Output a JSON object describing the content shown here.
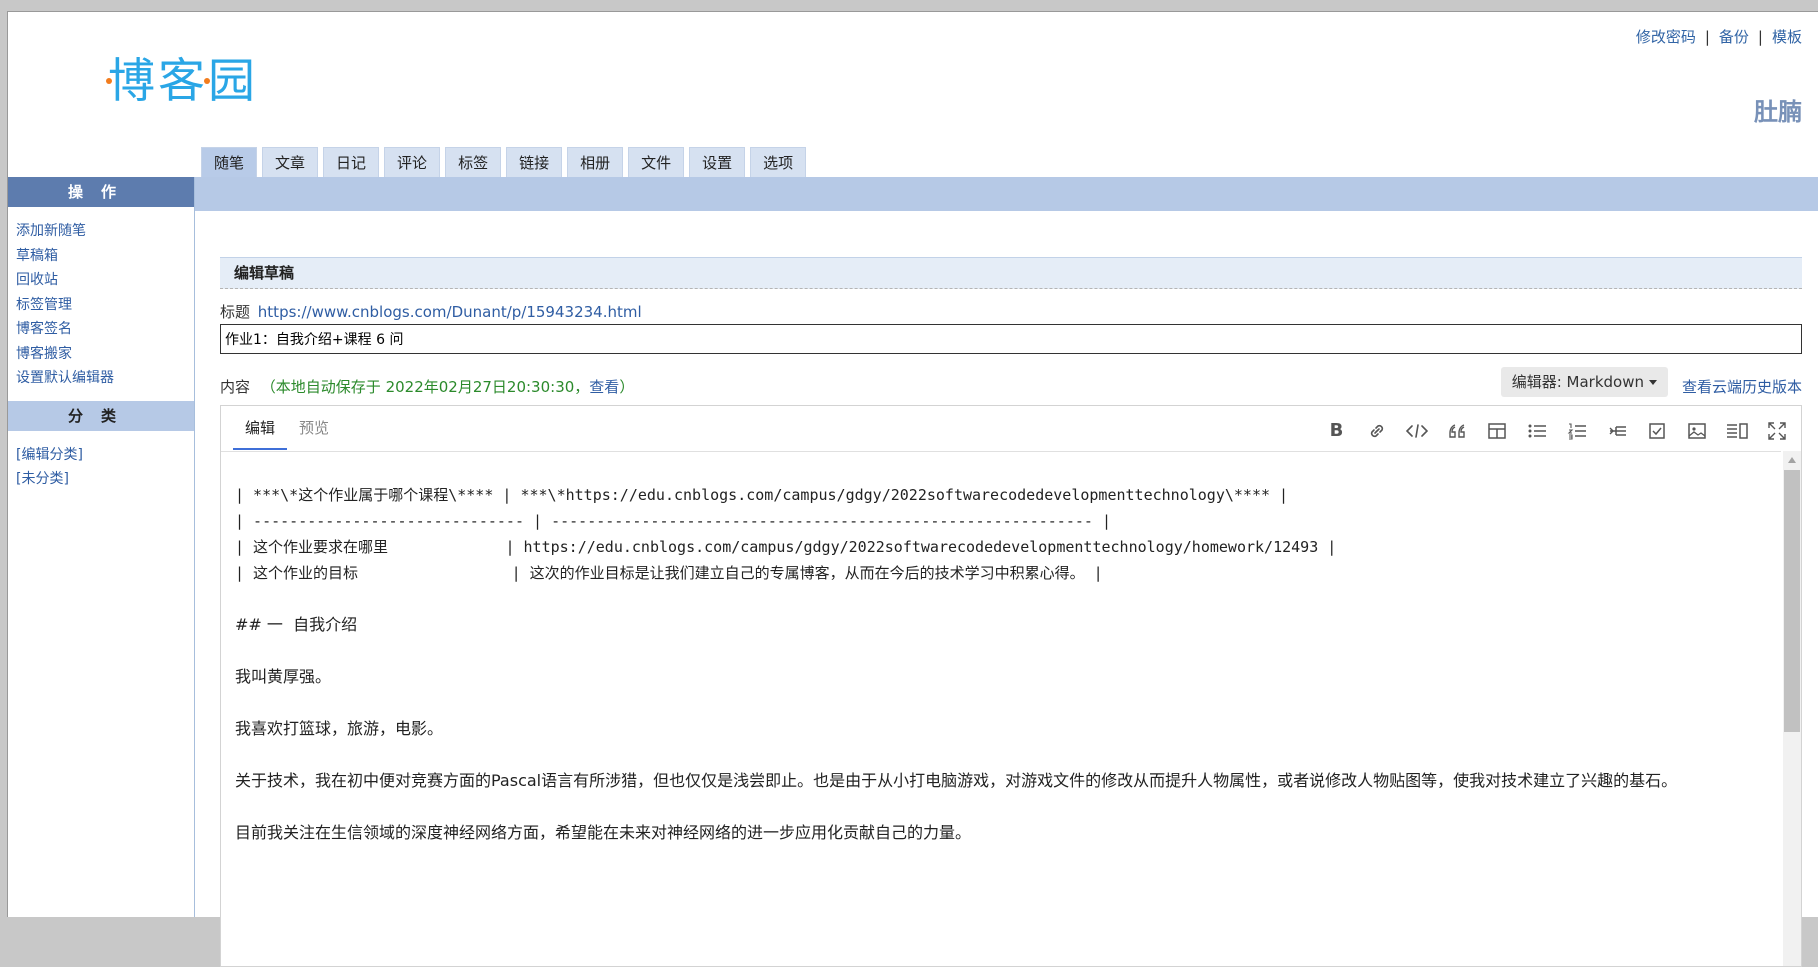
{
  "brand": {
    "logo_text": "博客园"
  },
  "top_links": [
    "修改密码",
    "备份",
    "模板"
  ],
  "top_sep": "|",
  "username": "肚腩",
  "tabs": [
    {
      "label": "随笔",
      "active": true
    },
    {
      "label": "文章"
    },
    {
      "label": "日记"
    },
    {
      "label": "评论"
    },
    {
      "label": "标签"
    },
    {
      "label": "链接"
    },
    {
      "label": "相册"
    },
    {
      "label": "文件"
    },
    {
      "label": "设置"
    },
    {
      "label": "选项"
    }
  ],
  "sidebar": {
    "ops_header": "操作",
    "ops": [
      "添加新随笔",
      "草稿箱",
      "回收站",
      "标签管理",
      "博客签名",
      "博客搬家",
      "设置默认编辑器"
    ],
    "cat_header": "分类",
    "cats": [
      "[编辑分类]",
      "[未分类]"
    ]
  },
  "main": {
    "header": "编辑草稿",
    "title_label": "标题",
    "title_url": "https://www.cnblogs.com/Dunant/p/15943234.html",
    "title_value": "作业1：自我介绍+课程 6 问",
    "content_label": "内容",
    "autosave_text": "（本地自动保存于 2022年02月27日20:30:30，",
    "autosave_link": "查看",
    "autosave_close": "）",
    "editor_select": "编辑器: Markdown",
    "history_link": "查看云端历史版本"
  },
  "editor": {
    "tabs": [
      "编辑",
      "预览"
    ],
    "toolbar_icons": [
      "bold-icon",
      "link-icon",
      "code-icon",
      "quote-icon",
      "table-icon",
      "bullet-list-icon",
      "numbered-list-icon",
      "tree-icon",
      "checkbox-icon",
      "image-icon",
      "side-by-side-icon",
      "fullscreen-icon"
    ],
    "toolbar_bold_glyph": "B",
    "lines": [
      "| ***\\*这个作业属于哪个课程\\**** | ***\\*https://edu.cnblogs.com/campus/gdgy/2022softwarecodedevelopmenttechnology\\**** |",
      "| ------------------------------ | ------------------------------------------------------------ |",
      "| 这个作业要求在哪里             | https://edu.cnblogs.com/campus/gdgy/2022softwarecodedevelopmenttechnology/homework/12493 |",
      "| 这个作业的目标                 | 这次的作业目标是让我们建立自己的专属博客，从而在今后的技术学习中积累心得。 |",
      "",
      "## 一  自我介绍",
      "",
      "我叫黄厚强。",
      "",
      "我喜欢打篮球，旅游，电影。",
      "",
      "关于技术，我在初中便对竞赛方面的Pascal语言有所涉猎，但也仅仅是浅尝即止。也是由于从小打电脑游戏，对游戏文件的修改从而提升人物属性，或者说修改人物贴图等，使我对技术建立了兴趣的基石。",
      "",
      "目前我关注在生信领域的深度神经网络方面，希望能在未来对神经网络的进一步应用化贡献自己的力量。"
    ]
  }
}
